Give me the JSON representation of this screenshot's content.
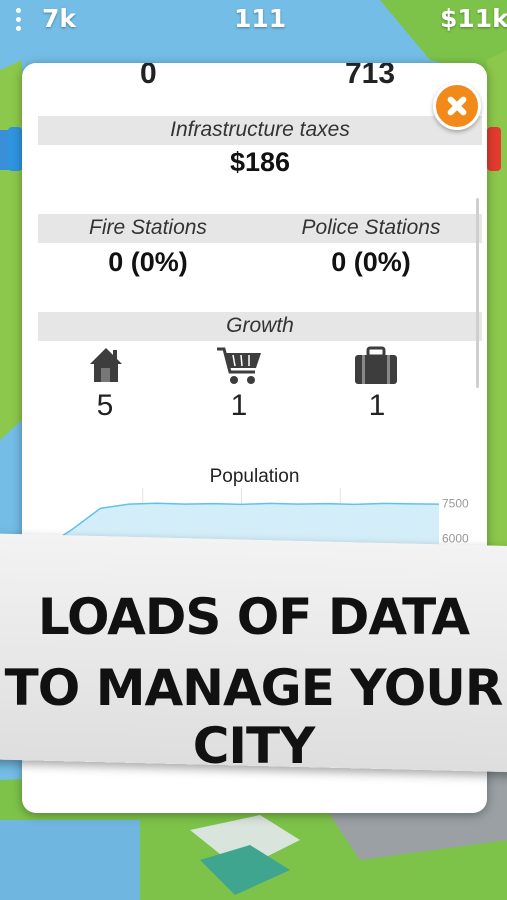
{
  "topbar": {
    "left_value": "7k",
    "center_value": "111",
    "right_value": "$11k"
  },
  "panel": {
    "partial_left": "0",
    "partial_right": "713",
    "infrastructure": {
      "title": "Infrastructure taxes",
      "value": "$186"
    },
    "fire": {
      "title": "Fire Stations",
      "value": "0 (0%)"
    },
    "police": {
      "title": "Police Stations",
      "value": "0 (0%)"
    },
    "growth": {
      "title": "Growth",
      "items": [
        {
          "icon": "house-icon",
          "value": "5"
        },
        {
          "icon": "shopping-cart-icon",
          "value": "1"
        },
        {
          "icon": "briefcase-icon",
          "value": "1"
        }
      ]
    }
  },
  "chart_data": {
    "type": "area",
    "title": "Population",
    "ytick_labels": [
      "7500",
      "6000"
    ],
    "series": [
      {
        "values": [
          5600,
          6400,
          7300,
          7480,
          7520,
          7480,
          7500,
          7470,
          7510,
          7480,
          7500,
          7470,
          7510,
          7490,
          7480
        ]
      }
    ],
    "color": "#5bc4ec",
    "grid": true
  },
  "banner": {
    "line1": "LOADS OF DATA",
    "line2": "TO MANAGE YOUR CITY"
  },
  "colors": {
    "close_button": "#f28a1a",
    "section_bar": "#e6e6e6",
    "sky": "#6fb6e0",
    "grass": "#7dc349"
  }
}
